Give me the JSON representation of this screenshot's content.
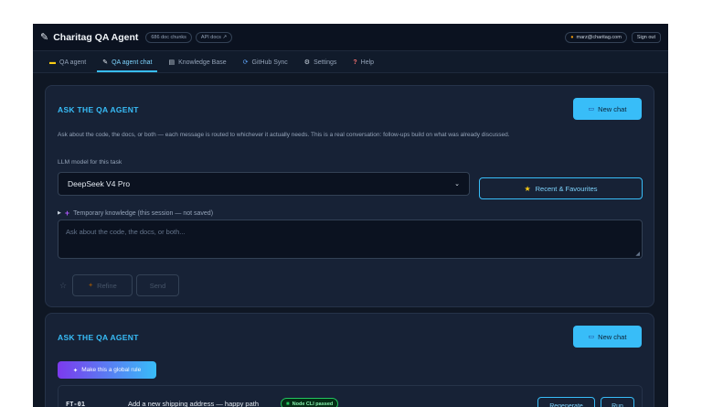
{
  "header": {
    "title": "Charitag QA Agent",
    "doc_chunks": "686 doc chunks",
    "api_docs": "API docs ↗",
    "user_email": "marz@charitag.com",
    "sign_out": "Sign out"
  },
  "tabs": [
    {
      "label": "QA agent",
      "icon": "card-icon",
      "active": false
    },
    {
      "label": "QA agent chat",
      "icon": "pencil-icon",
      "active": true
    },
    {
      "label": "Knowledge Base",
      "icon": "books-icon",
      "active": false
    },
    {
      "label": "GitHub Sync",
      "icon": "sync-icon",
      "active": false
    },
    {
      "label": "Settings",
      "icon": "gear-icon",
      "active": false
    },
    {
      "label": "Help",
      "icon": "question-icon",
      "active": false
    }
  ],
  "chat_card": {
    "title": "ASK THE QA AGENT",
    "new_chat": "New chat",
    "description": "Ask about the code, the docs, or both — each message is routed to whichever it actually needs. This is a real conversation: follow-ups build on what was already discussed.",
    "model_label": "LLM model for this task",
    "model_selected": "DeepSeek V4 Pro",
    "recent_favourites": "Recent & Favourites",
    "temp_knowledge": "Temporary knowledge (this session — not saved)",
    "input_placeholder": "Ask about the code, the docs, or both...",
    "refine": "Refine",
    "send": "Send"
  },
  "result_card": {
    "title": "ASK THE QA AGENT",
    "new_chat": "New chat",
    "global_rule": "Make this a global rule",
    "test": {
      "id": "FT-01",
      "title": "Add a new shipping address — happy path",
      "status": "Node CLI passed",
      "regenerate": "Regenerate",
      "run": "Run"
    }
  },
  "colors": {
    "accent": "#38bdf8",
    "background": "#0f1724",
    "card": "#172236",
    "success": "#22c55e"
  }
}
